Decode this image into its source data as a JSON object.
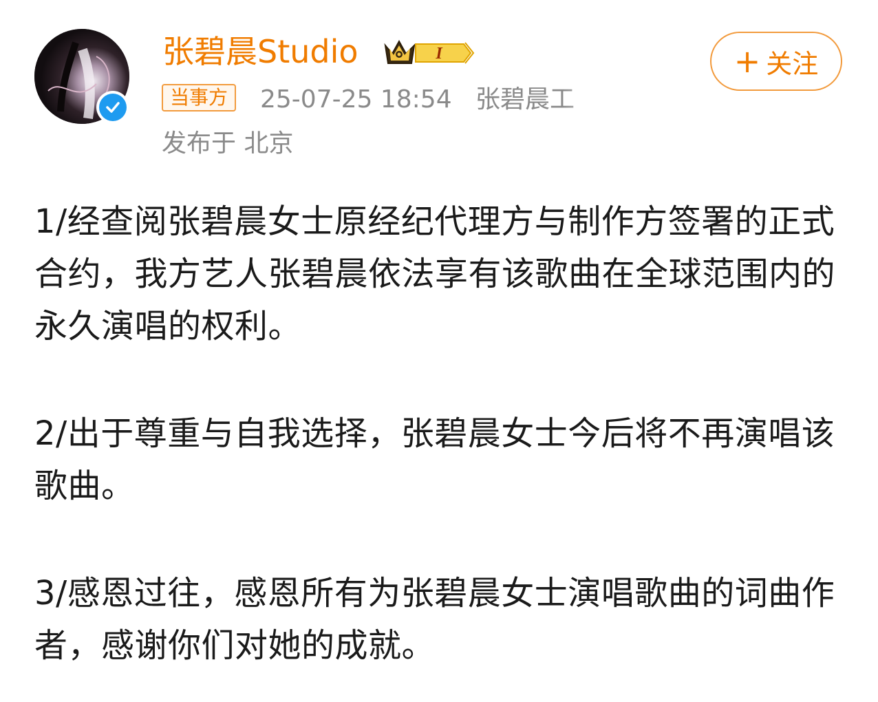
{
  "header": {
    "username": "张碧晨Studio",
    "level_badge": "I",
    "party_tag": "当事方",
    "timestamp": "25-07-25 18:54",
    "source_truncated": "张碧晨工",
    "location": "发布于 北京",
    "follow": {
      "plus": "+",
      "label": "关注"
    }
  },
  "post": {
    "paragraphs": [
      "1/经查阅张碧晨女士原经纪代理方与制作方签署的正式合约，我方艺人张碧晨依法享有该歌曲在全球范围内的永久演唱的权利。",
      "2/出于尊重与自我选择，张碧晨女士今后将不再演唱该歌曲。",
      "3/感恩过往，感恩所有为张碧晨女士演唱歌曲的词曲作者，感谢你们对她的成就。"
    ]
  },
  "colors": {
    "brand_orange": "#f07c00",
    "border_orange": "#f29a3c",
    "meta_gray": "#8a8a8a",
    "verified_blue": "#1e9bf0",
    "crown_gold": "#f4c542"
  },
  "icons": {
    "avatar": "avatar-photo",
    "verified": "verified-check-icon",
    "crown": "crown-icon"
  }
}
